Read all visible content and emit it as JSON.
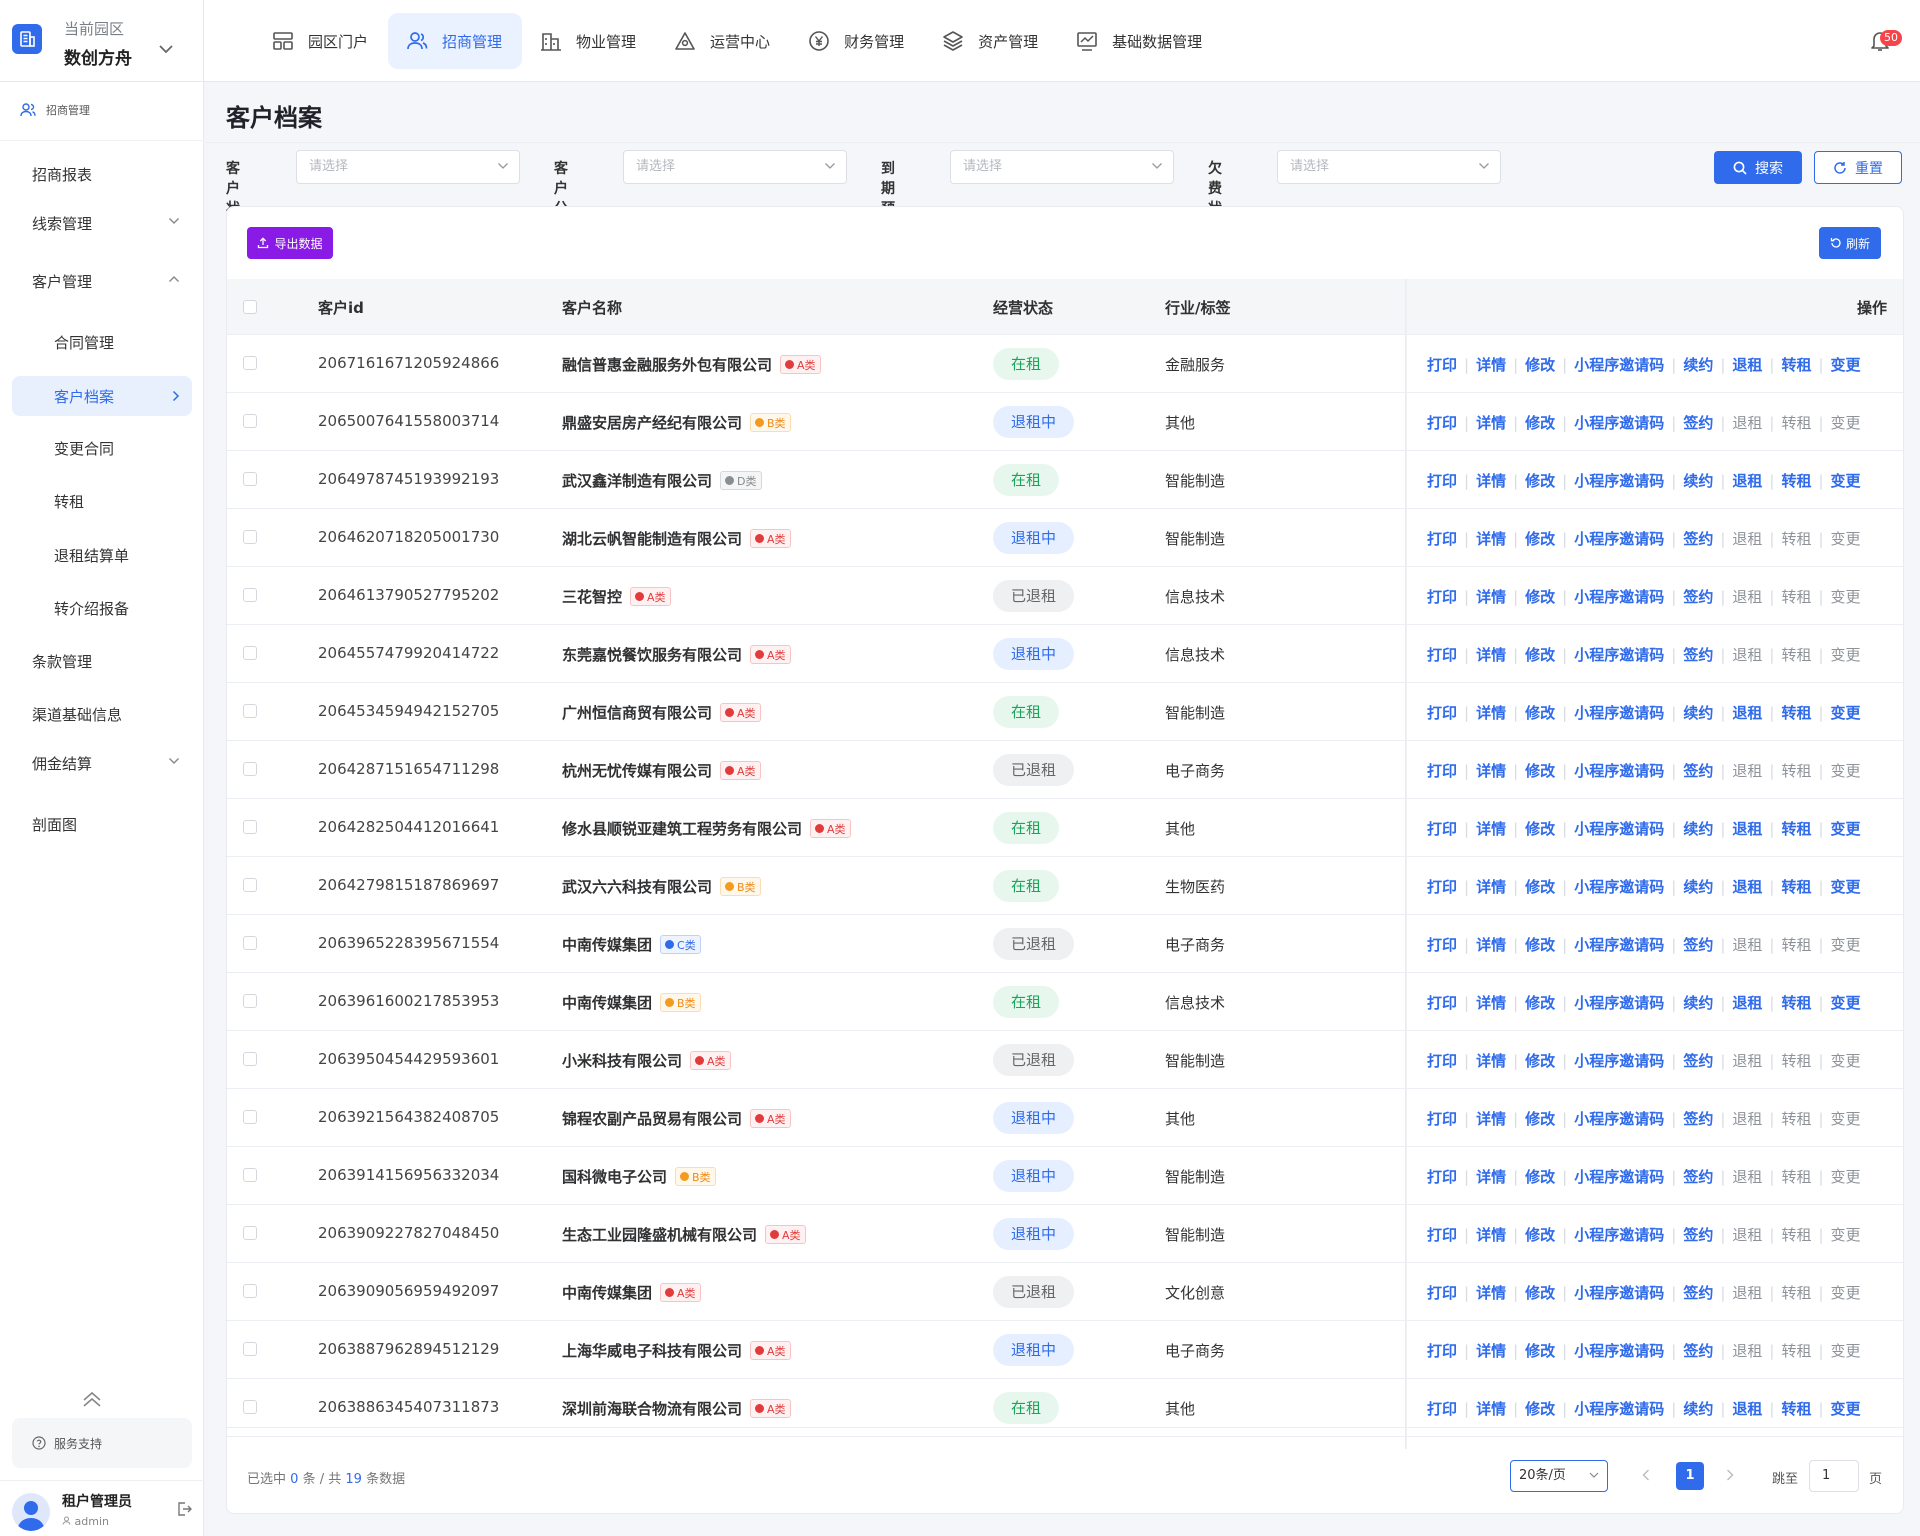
{
  "topbar": {
    "park_label": "当前园区",
    "park_name": "数创方舟",
    "nav": [
      "园区门户",
      "招商管理",
      "物业管理",
      "运营中心",
      "财务管理",
      "资产管理",
      "基础数据管理"
    ],
    "notification_count": "50"
  },
  "sidebar": {
    "header": "招商管理",
    "items": [
      "招商报表",
      "线索管理",
      "客户管理",
      "合同管理",
      "客户档案",
      "变更合同",
      "转租",
      "退租结算单",
      "转介绍报备",
      "条款管理",
      "渠道基础信息",
      "佣金结算",
      "剖面图"
    ],
    "support": "服务支持",
    "user_name": "租户管理员",
    "user_role": "admin"
  },
  "page": {
    "title": "客户档案"
  },
  "filters": {
    "status_label": "客户状态",
    "tier_label": "客户分层",
    "expiry_label": "到期预警",
    "arrears_label": "欠费状态",
    "placeholder": "请选择",
    "search": "搜索",
    "reset": "重置"
  },
  "toolbar": {
    "export": "导出数据",
    "refresh": "刷新"
  },
  "table": {
    "headers": {
      "id": "客户id",
      "name": "客户名称",
      "status": "经营状态",
      "industry": "行业/标签",
      "ops": "操作"
    },
    "ops": [
      "打印",
      "详情",
      "修改",
      "小程序邀请码",
      "签约",
      "续约",
      "退租",
      "转租",
      "变更"
    ],
    "rows": [
      {
        "id": "2067161671205924866",
        "name": "融信普惠金融服务外包有限公司",
        "cls": "A类",
        "status": "在租",
        "industry": "金融服务"
      },
      {
        "id": "2065007641558003714",
        "name": "鼎盛安居房产经纪有限公司",
        "cls": "B类",
        "status": "退租中",
        "industry": "其他"
      },
      {
        "id": "2064978745193992193",
        "name": "武汉鑫洋制造有限公司",
        "cls": "D类",
        "status": "在租",
        "industry": "智能制造"
      },
      {
        "id": "2064620718205001730",
        "name": "湖北云帆智能制造有限公司",
        "cls": "A类",
        "status": "退租中",
        "industry": "智能制造"
      },
      {
        "id": "2064613790527795202",
        "name": "三花智控",
        "cls": "A类",
        "status": "已退租",
        "industry": "信息技术"
      },
      {
        "id": "2064557479920414722",
        "name": "东莞嘉悦餐饮服务有限公司",
        "cls": "A类",
        "status": "退租中",
        "industry": "信息技术"
      },
      {
        "id": "2064534594942152705",
        "name": "广州恒信商贸有限公司",
        "cls": "A类",
        "status": "在租",
        "industry": "智能制造"
      },
      {
        "id": "2064287151654711298",
        "name": "杭州无忧传媒有限公司",
        "cls": "A类",
        "status": "已退租",
        "industry": "电子商务"
      },
      {
        "id": "2064282504412016641",
        "name": "修水县顺锐亚建筑工程劳务有限公司",
        "cls": "A类",
        "status": "在租",
        "industry": "其他"
      },
      {
        "id": "2064279815187869697",
        "name": "武汉六六科技有限公司",
        "cls": "B类",
        "status": "在租",
        "industry": "生物医药"
      },
      {
        "id": "2063965228395671554",
        "name": "中南传媒集团",
        "cls": "C类",
        "status": "已退租",
        "industry": "电子商务"
      },
      {
        "id": "2063961600217853953",
        "name": "中南传媒集团",
        "cls": "B类",
        "status": "在租",
        "industry": "信息技术"
      },
      {
        "id": "2063950454429593601",
        "name": "小米科技有限公司",
        "cls": "A类",
        "status": "已退租",
        "industry": "智能制造"
      },
      {
        "id": "2063921564382408705",
        "name": "锦程农副产品贸易有限公司",
        "cls": "A类",
        "status": "退租中",
        "industry": "其他"
      },
      {
        "id": "2063914156956332034",
        "name": "国科微电子公司",
        "cls": "B类",
        "status": "退租中",
        "industry": "智能制造"
      },
      {
        "id": "2063909227827048450",
        "name": "生态工业园隆盛机械有限公司",
        "cls": "A类",
        "status": "退租中",
        "industry": "智能制造"
      },
      {
        "id": "2063909056959492097",
        "name": "中南传媒集团",
        "cls": "A类",
        "status": "已退租",
        "industry": "文化创意"
      },
      {
        "id": "2063887962894512129",
        "name": "上海华威电子科技有限公司",
        "cls": "A类",
        "status": "退租中",
        "industry": "电子商务"
      },
      {
        "id": "2063886345407311873",
        "name": "深圳前海联合物流有限公司",
        "cls": "A类",
        "status": "在租",
        "industry": "其他"
      }
    ]
  },
  "footer": {
    "selected_prefix": "已选中",
    "selected_count": "0",
    "selected_mid": "条 / 共",
    "total": "19",
    "total_suffix": "条数据",
    "page_size": "20条/页",
    "current_page": "1",
    "jump_label": "跳至",
    "jump_value": "1",
    "page_unit": "页"
  },
  "colors": {
    "primary": "#2f6bea",
    "export": "#8a1be6",
    "active_status": "#1aa55a",
    "leaving_status": "#2f6bea",
    "left_status": "#666666"
  }
}
